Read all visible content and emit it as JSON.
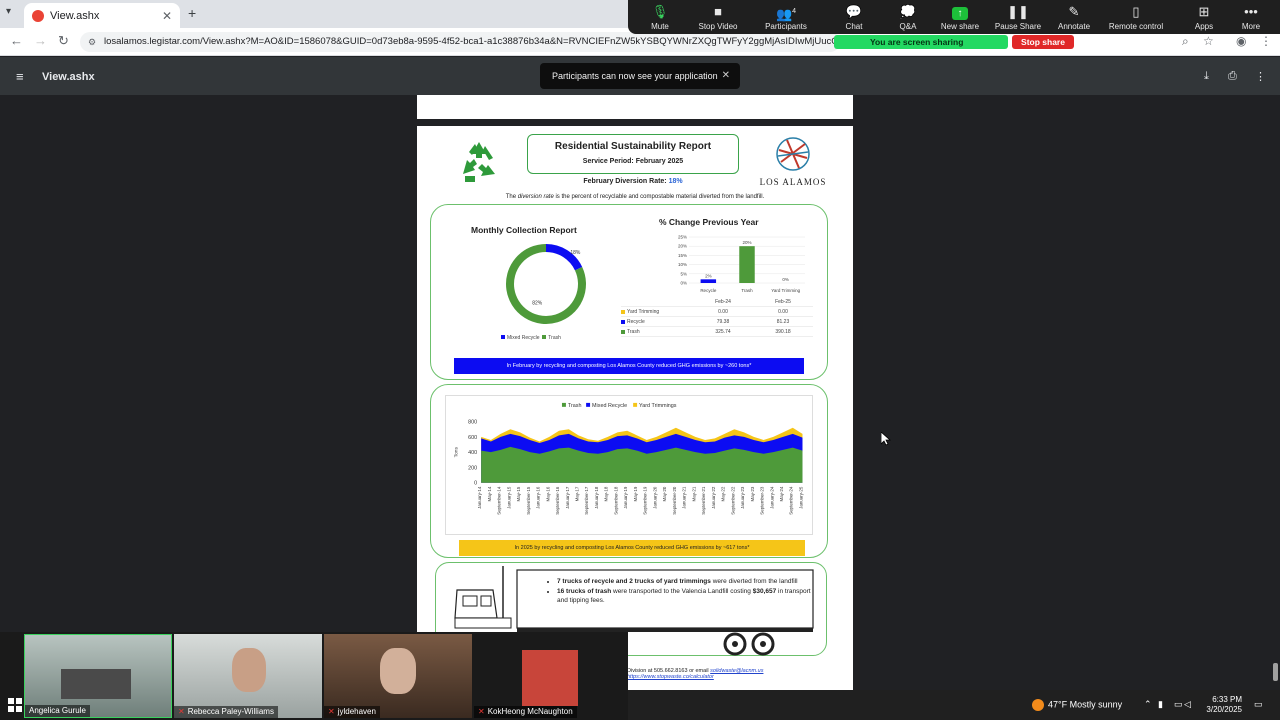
{
  "browser": {
    "tab_title": "View.ashx",
    "url": "losalamos.legistar.com/View.ashx?M=AO&ID=1586078&GUID=0d73eb8a-9595-4f52-bca1-a1c38876b34a&N=RVNCIEFnZW5kYSBQYWNrZXQgTWFyY2ggMjAsIDIwMjUucGRm"
  },
  "zoom": {
    "buttons": [
      "Mute",
      "Stop Video",
      "Participants",
      "Chat",
      "Q&A",
      "New share",
      "Pause Share",
      "Annotate",
      "Remote control",
      "Apps",
      "More"
    ],
    "participants_count": "4",
    "sharing_label": "You are screen sharing",
    "stop_share_label": "Stop share",
    "toast": "Participants can now see your application",
    "gallery": [
      "Angelica Gurule",
      "Rebecca Paley-Williams",
      "jyldehaven",
      "KokHeong McNaughton"
    ]
  },
  "viewer": {
    "title": "View.ashx"
  },
  "report": {
    "title": "Residential Sustainability Report",
    "period": "Service Period: February 2025",
    "diversion_label": "February Diversion Rate:",
    "diversion_value": "18%",
    "note_pre": "The ",
    "note_em": "diversion rate",
    "note_post": " is the percent of recyclable and compostable material diverted from the landfill.",
    "logo_text": "LOS ALAMOS",
    "monthly_title": "Monthly Collection Report",
    "pct_title": "% Change Previous Year",
    "donut_legend": [
      "Mixed Recycle",
      "Trash"
    ],
    "table_headers": [
      "",
      "Feb-24",
      "Feb-25"
    ],
    "table_rows": [
      {
        "label": "Yard Trimming",
        "feb24": "0.00",
        "feb25": "0.00",
        "color": "#f5c518"
      },
      {
        "label": "Recycle",
        "feb24": "79.38",
        "feb25": "81.23",
        "color": "#0c0cf2"
      },
      {
        "label": "Trash",
        "feb24": "325.74",
        "feb25": "390.18",
        "color": "#4e9a3a"
      }
    ],
    "ghg1": "In February by recycling and composting Los Alamos County reduced GHG emissions by ~260 tons*",
    "ghg2": "In 2025 by recycling and composting Los Alamos County reduced GHG emissions by ~617 tons*",
    "truck_b1_bold": "7 trucks of recycle and 2 trucks of yard trimmings",
    "truck_b1_rest": " were diverted from the landfill",
    "truck_b2_bold": "16 trucks of trash",
    "truck_b2_mid": " were transported to the Valencia Landfill costing ",
    "truck_b2_cost": "$30,657",
    "truck_b2_rest": " in transport and tipping fees.",
    "footer_l1": "Division at 505.662.8163 or email ",
    "footer_email": "solidwaste@lacnm.us",
    "footer_l2": "https://www.stopwaste.co/calculator"
  },
  "chart_data": [
    {
      "type": "pie",
      "title": "Monthly Collection Report",
      "categories": [
        "Mixed Recycle",
        "Trash"
      ],
      "values": [
        18,
        82
      ],
      "colors": [
        "#0c0cf2",
        "#4e9a3a"
      ],
      "labels": [
        "18%",
        "82%"
      ]
    },
    {
      "type": "bar",
      "title": "% Change Previous Year",
      "categories": [
        "Recycle",
        "Trash",
        "Yard Trimming"
      ],
      "values": [
        2,
        20,
        0
      ],
      "labels": [
        "2%",
        "20%",
        "0%"
      ],
      "colors": [
        "#0c0cf2",
        "#4e9a3a",
        "#f5c518"
      ],
      "ylim": [
        0,
        25
      ],
      "yticks": [
        "0%",
        "5%",
        "10%",
        "15%",
        "20%",
        "25%"
      ]
    },
    {
      "type": "area",
      "ylabel": "Tons",
      "ylim": [
        0,
        800
      ],
      "yticks": [
        "0",
        "200",
        "400",
        "600",
        "800"
      ],
      "legend": [
        "Trash",
        "Mixed Recycle",
        "Yard Trimmings"
      ],
      "colors": [
        "#4e9a3a",
        "#0c0cf2",
        "#f5c518"
      ],
      "x_ticks": [
        "January-14",
        "May-14",
        "September-14",
        "January-15",
        "May-15",
        "September-15",
        "January-16",
        "May-16",
        "September-16",
        "January-17",
        "May-17",
        "September-17",
        "January-18",
        "May-18",
        "September-18",
        "January-19",
        "May-19",
        "September-19",
        "January-20",
        "May-20",
        "September-20",
        "January-21",
        "May-21",
        "September-21",
        "January-22",
        "May-22",
        "September-22",
        "January-23",
        "May-23",
        "September-23",
        "January-24",
        "May-24",
        "September-24",
        "January-25"
      ],
      "series": [
        {
          "name": "Trash",
          "values": [
            420,
            400,
            430,
            470,
            440,
            400,
            380,
            410,
            450,
            460,
            420,
            390,
            380,
            400,
            440,
            450,
            420,
            380,
            400,
            430,
            460,
            430,
            400,
            380,
            390,
            420,
            450,
            430,
            400,
            380,
            400,
            430,
            460,
            420
          ]
        },
        {
          "name": "Mixed Recycle",
          "values": [
            580,
            540,
            600,
            640,
            610,
            560,
            520,
            560,
            620,
            640,
            580,
            540,
            530,
            560,
            610,
            620,
            580,
            530,
            560,
            600,
            640,
            600,
            560,
            530,
            540,
            590,
            620,
            600,
            560,
            530,
            560,
            600,
            640,
            590
          ]
        },
        {
          "name": "Yard Trimmings",
          "values": [
            600,
            560,
            640,
            700,
            660,
            590,
            540,
            600,
            680,
            700,
            620,
            570,
            550,
            600,
            660,
            680,
            620,
            560,
            600,
            660,
            720,
            660,
            600,
            560,
            580,
            640,
            700,
            660,
            600,
            560,
            600,
            660,
            720,
            640
          ]
        }
      ]
    }
  ],
  "taskbar": {
    "weather": "47°F  Mostly sunny",
    "time": "6:33 PM",
    "date": "3/20/2025"
  }
}
